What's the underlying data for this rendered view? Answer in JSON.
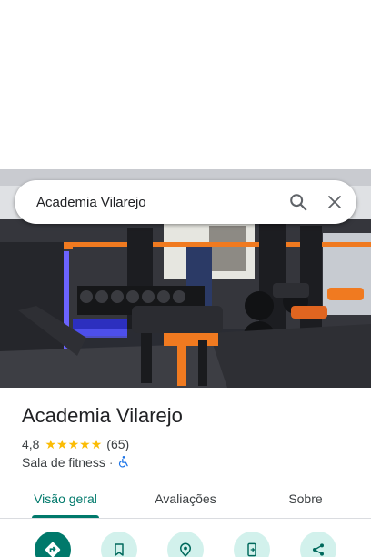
{
  "search": {
    "query": "Academia Vilarejo",
    "search_icon": "search-icon",
    "close_icon": "close-icon"
  },
  "photo": {
    "icon": "gym-photo"
  },
  "place": {
    "name": "Academia Vilarejo",
    "rating": "4,8",
    "stars": 5,
    "review_count": "(65)",
    "category": "Sala de fitness",
    "separator": "·",
    "accessibility_icon": "wheelchair-accessible-icon"
  },
  "tabs": [
    {
      "label": "Visão geral",
      "active": true
    },
    {
      "label": "Avaliações",
      "active": false
    },
    {
      "label": "Sobre",
      "active": false
    }
  ],
  "actions": [
    {
      "icon": "directions-icon"
    },
    {
      "icon": "bookmark-icon"
    },
    {
      "icon": "nearby-icon"
    },
    {
      "icon": "send-to-phone-icon"
    },
    {
      "icon": "share-icon"
    }
  ],
  "colors": {
    "accent": "#00796b",
    "accent_light": "#d2f1ec",
    "star": "#fbbc04",
    "text": "#202124",
    "secondary_text": "#3c4043"
  }
}
